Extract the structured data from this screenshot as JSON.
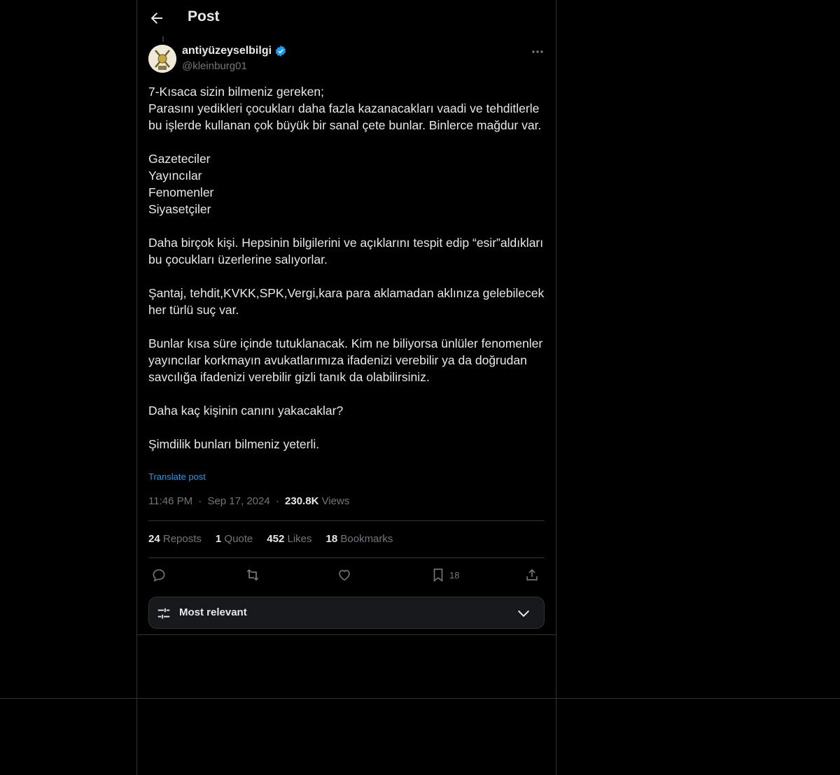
{
  "header": {
    "title": "Post"
  },
  "author": {
    "name": "antiyüzeyselbilgi",
    "handle": "@kleinburg01",
    "verified": true
  },
  "post": {
    "text": "7-Kısaca sizin bilmeniz gereken;\nParasını yedikleri çocukları daha fazla kazanacakları vaadi ve tehditlerle bu işlerde kullanan çok büyük bir sanal çete bunlar. Binlerce mağdur var.\n\nGazeteciler\nYayıncılar\nFenomenler\nSiyasetçiler\n\nDaha birçok kişi. Hepsinin bilgilerini ve açıklarını tespit edip “esir”aldıkları bu çocukları üzerlerine salıyorlar.\n\nŞantaj, tehdit,KVKK,SPK,Vergi,kara para aklamadan aklınıza gelebilecek her türlü suç var.\n\nBunlar kısa süre içinde tutuklanacak. Kim ne biliyorsa ünlüler fenomenler yayıncılar korkmayın avukatlarımıza ifadenizi verebilir ya da doğrudan savcılığa ifadenizi verebilir gizli tanık da olabilirsiniz.\n\nDaha kaç kişinin canını yakacaklar?\n\nŞimdilik bunları bilmeniz yeterli.",
    "translate_label": "Translate post",
    "time": "11:46 PM",
    "date": "Sep 17, 2024",
    "views_count": "230.8K",
    "views_label": "Views",
    "dot": "·"
  },
  "stats": {
    "reposts_count": "24",
    "reposts_label": "Reposts",
    "quotes_count": "1",
    "quotes_label": "Quote",
    "likes_count": "452",
    "likes_label": "Likes",
    "bookmarks_count": "18",
    "bookmarks_label": "Bookmarks"
  },
  "actions": {
    "bookmark_count": "18"
  },
  "sort": {
    "label": "Most relevant"
  },
  "colors": {
    "accent": "#1d9bf0",
    "muted": "#71767b",
    "border": "#2f3336",
    "text": "#e7e9ea"
  }
}
